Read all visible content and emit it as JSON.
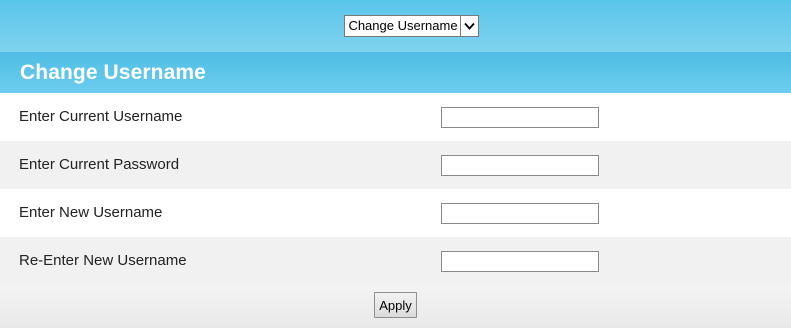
{
  "menu": {
    "selected_option": "Change Username",
    "icon": "chevron-down-icon"
  },
  "section": {
    "title": "Change Username"
  },
  "form": {
    "fields": [
      {
        "label": "Enter Current Username",
        "value": "",
        "placeholder": ""
      },
      {
        "label": "Enter Current Password",
        "value": "",
        "placeholder": ""
      },
      {
        "label": "Enter New Username",
        "value": "",
        "placeholder": ""
      },
      {
        "label": "Re-Enter New Username",
        "value": "",
        "placeholder": ""
      }
    ],
    "apply_label": "Apply"
  },
  "colors": {
    "header_blue": "#59c5ea",
    "section_blue": "#4fbde4",
    "row_gray": "#f1f1f1"
  }
}
